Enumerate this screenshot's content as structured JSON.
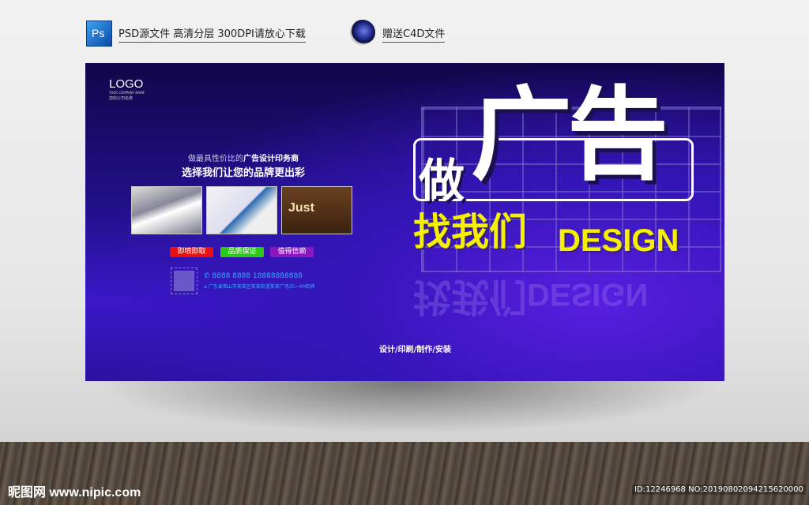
{
  "header": {
    "ps_label": "Ps",
    "ps_text": "PSD源文件  高清分层 300DPI请放心下载",
    "c4d_text": "赠送C4D文件"
  },
  "poster": {
    "logo": "LOGO",
    "company_en": "YOUR COMPANY NAME",
    "company_cn": "您的公司名称",
    "tagline1_a": "做最具性价比的",
    "tagline1_b": "广告设计印务商",
    "tagline2": "选择我们让您的品牌更出彩",
    "photo3_text": "Just",
    "buttons": [
      {
        "label": "即喷即取",
        "color": "#e81010"
      },
      {
        "label": "品质保证",
        "color": "#2ec81a"
      },
      {
        "label": "值得信赖",
        "color": "#8a18c0"
      }
    ],
    "phone": "8888 8888   18888888888",
    "address": "广东省佛山市某某区某某街道某某广场35~40商铺",
    "headline_1": "做",
    "headline_2": "广告",
    "headline_3": "找我们",
    "headline_4": "DESIGN",
    "services": "设计/印刷/制作/安装"
  },
  "footer": {
    "site": "昵图网 www.nipic.com",
    "id": "ID:12246968 NO:20190802094215620000"
  }
}
